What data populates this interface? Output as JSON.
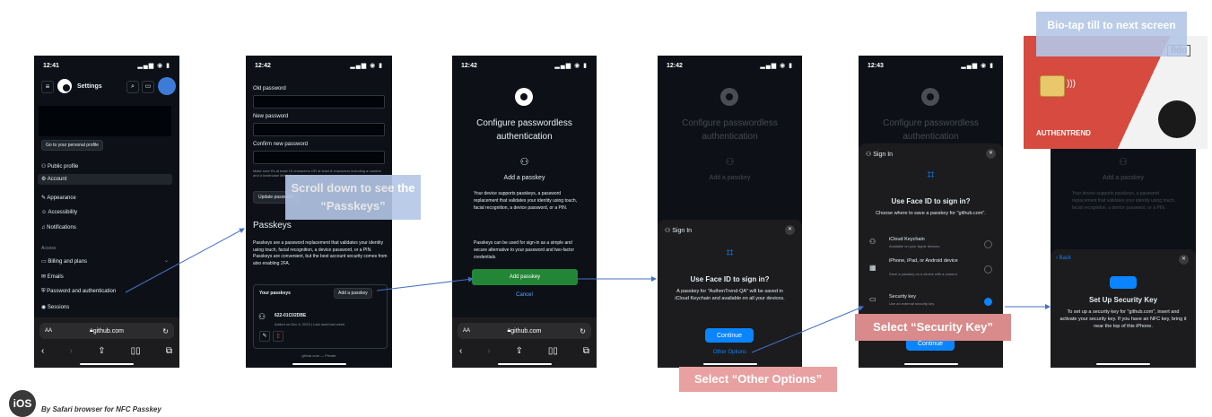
{
  "common": {
    "url": "github.com",
    "aa": "AA"
  },
  "screen1": {
    "time": "12:41",
    "header_title": "Settings",
    "profile_button": "Go to your personal profile",
    "menu": [
      "Public profile",
      "Account",
      "Appearance",
      "Accessibility",
      "Notifications"
    ],
    "access_heading": "Access",
    "access_menu": [
      "Billing and plans",
      "Emails",
      "Password and authentication",
      "Sessions"
    ]
  },
  "screen2": {
    "time": "12:42",
    "old_password": "Old password",
    "new_password": "New password",
    "confirm_password": "Confirm new password",
    "hint": "Make sure it's at least 15 characters OR at least 8 characters including a number and a lowercase letter. Learn more.",
    "update_button": "Update password",
    "passkeys_heading": "Passkeys",
    "passkeys_desc": "Passkeys are a password replacement that validates your identity using touch, facial recognition, a device password, or a PIN. Passkeys are convenient, but the best account security comes from also enabling 2FA.",
    "your_passkeys": "Your passkeys",
    "add_passkey_button": "Add a passkey",
    "passkey_name": "622-01C02DBE",
    "passkey_meta": "Added on Dec 5, 2023 | Last used last week",
    "footer": "github.com — Private"
  },
  "screen3": {
    "time": "12:42",
    "title": "Configure passwordless authentication",
    "add_heading": "Add a passkey",
    "desc1": "Your device supports passkeys, a password replacement that validates your identity using touch, facial recognition, a device password, or a PIN.",
    "desc2": "Passkeys can be used for sign-in as a simple and secure alternative to your password and two-factor credentials.",
    "add_button": "Add passkey",
    "cancel": "Cancel"
  },
  "screen4": {
    "time": "12:42",
    "sheet_title": "Sign In",
    "heading": "Use Face ID to sign in?",
    "desc": "A passkey for \"AuthenTrend-QA\" will be saved in iCloud Keychain and available on all your devices.",
    "continue": "Continue",
    "other_options": "Other Options"
  },
  "screen5": {
    "time": "12:43",
    "sheet_title": "Sign In",
    "heading": "Use Face ID to sign in?",
    "desc": "Choose where to save a passkey for \"github.com\".",
    "options": [
      {
        "title": "iCloud Keychain",
        "sub": "Available on your Apple devices"
      },
      {
        "title": "iPhone, iPad, or Android device",
        "sub": "Save a passkey on a device with a camera"
      },
      {
        "title": "Security key",
        "sub": "Use an external security key"
      }
    ],
    "continue": "Continue"
  },
  "screen6": {
    "back": "Back",
    "heading": "Set Up Security Key",
    "desc": "To set up a security key for \"github.com\", insert and activate your security key. If you have an NFC key, bring it near the top of this iPhone.",
    "card_brand": "AUTHENTREND",
    "fido": "fido"
  },
  "callouts": {
    "scroll": "Scroll down to see the “Passkeys”",
    "other_options": "Select “Other Options”",
    "security_key": "Select “Security Key”",
    "bio_tap": "Bio-tap till to next screen"
  },
  "footer": {
    "ios_badge": "iOS",
    "caption": "By Safari browser for NFC Passkey"
  },
  "colors": {
    "github_bg": "#0d1117",
    "green": "#238636",
    "ios_blue": "#0a84ff",
    "callout_blue": "#b4c7e7",
    "callout_red": "#e8a0a0",
    "arrow": "#4472c4"
  }
}
